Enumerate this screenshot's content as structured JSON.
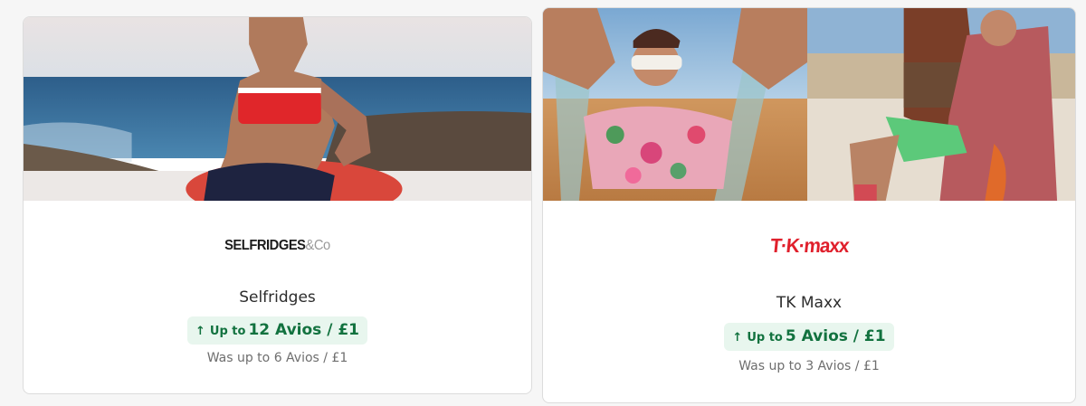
{
  "retailers": [
    {
      "logo_text": "SELFRIDGES",
      "logo_suffix": "&Co",
      "name": "Selfridges",
      "badge_prefix": "Up to",
      "badge_rate": "12 Avios / £1",
      "was": "Was up to 6 Avios / £1",
      "image": "beach-model-photo"
    },
    {
      "logo_text": "T·K·maxx",
      "name": "TK Maxx",
      "badge_prefix": "Up to",
      "badge_rate": "5 Avios / £1",
      "was": "Was up to 3 Avios / £1",
      "image": "summer-models-photo"
    }
  ],
  "icons": {
    "badge_arrow": "arrow-up-icon"
  },
  "colors": {
    "badge_bg": "#e8f6ee",
    "badge_text": "#12723f",
    "tkmaxx_red": "#e0202c"
  }
}
